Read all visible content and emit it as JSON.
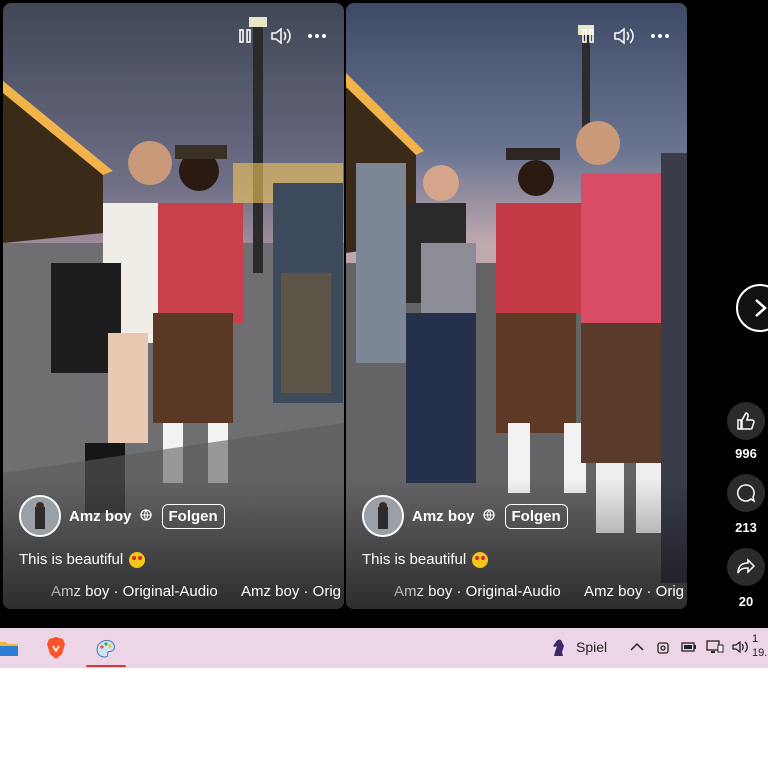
{
  "videos": [
    {
      "author": "Amz boy",
      "follow_label": "Folgen",
      "caption": "This is beautiful",
      "audio_a": "Amz boy · Original-Audio",
      "audio_b": "Amz boy · Orig"
    },
    {
      "author": "Amz boy",
      "follow_label": "Folgen",
      "caption": "This is beautiful",
      "audio_a": "Amz boy · Original-Audio",
      "audio_b": "Amz boy · Orig"
    }
  ],
  "actions": {
    "likes": "996",
    "comments": "213",
    "shares": "20"
  },
  "taskbar": {
    "game_label": "Spiel",
    "clock_top": "1",
    "clock_date": "19."
  },
  "icons": [
    "pause-icon",
    "volume-icon",
    "more-icon",
    "globe-icon",
    "like-icon",
    "comment-icon",
    "share-icon",
    "chevron-right-icon",
    "folder-icon",
    "brave-icon",
    "paint-icon",
    "chess-icon",
    "chevron-up-icon",
    "camera-icon",
    "battery-icon",
    "network-icon",
    "speaker-icon"
  ],
  "colors": {
    "stage": "#000000",
    "taskbar": "#ecd5e6",
    "active_indicator": "#dd3333"
  }
}
